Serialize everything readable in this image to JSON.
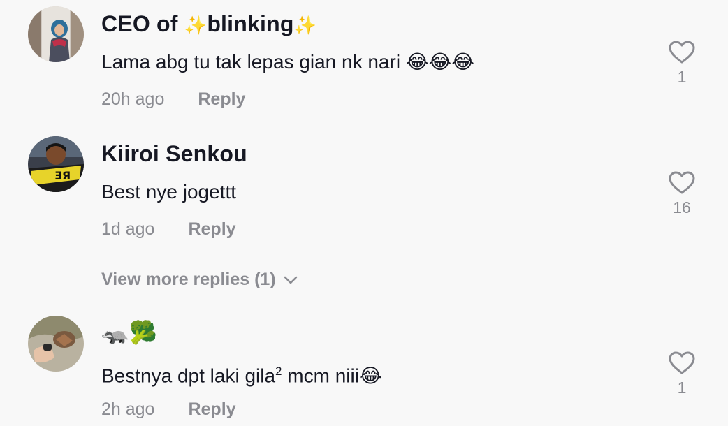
{
  "comments": [
    {
      "username_prefix": "CEO of ",
      "username_mid": "blinking",
      "sparkle_left": "✨",
      "sparkle_right": "✨",
      "text": "Lama abg tu tak lepas gian nk nari 😂😂😂",
      "time": "20h ago",
      "reply_label": "Reply",
      "likes": "1",
      "avatar_icon": "avatar-girl-hijab"
    },
    {
      "username": "Kiiroi Senkou",
      "text": "Best nye jogettt",
      "time": "1d ago",
      "reply_label": "Reply",
      "likes": "16",
      "avatar_icon": "avatar-man-yellow-scarf"
    },
    {
      "username": "🦡🥦",
      "text_main": "Bestnya dpt laki gila",
      "text_sup": "2",
      "text_tail": " mcm niii😂",
      "time": "2h ago",
      "reply_label": "Reply",
      "likes": "1",
      "avatar_icon": "avatar-hand-rock"
    }
  ],
  "view_more": "View more replies (1)",
  "icons": {
    "like": "heart-outline-icon",
    "expand": "chevron-down-icon"
  },
  "colors": {
    "background": "#f8f8f8",
    "primary_text": "#161823",
    "secondary_text": "#8a8b91"
  }
}
